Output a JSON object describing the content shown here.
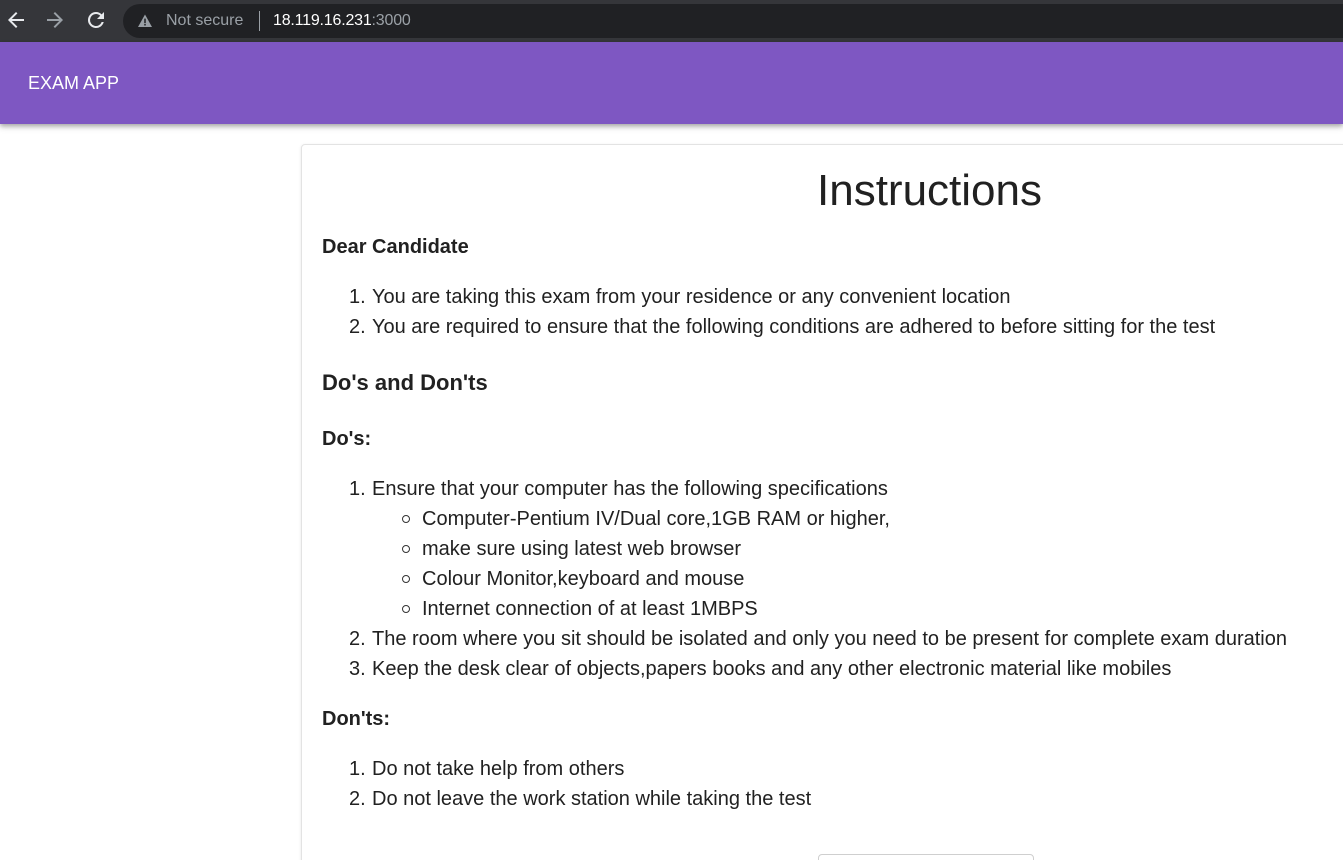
{
  "browser": {
    "not_secure": "Not secure",
    "url_host": "18.119.16.231",
    "url_port": ":3000"
  },
  "app": {
    "title": "EXAM APP",
    "accent": "#7e57c2"
  },
  "instructions": {
    "title": "Instructions",
    "greeting": "Dear Candidate",
    "intro": [
      "You are taking this exam from your residence or any convenient location",
      "You are required to ensure that the following conditions are adhered to before sitting for the test"
    ],
    "section_heading": "Do's and Don'ts",
    "dos_heading": "Do's:",
    "dos": [
      "Ensure that your computer has the following specifications",
      "The room where you sit should be isolated and only you need to be present for complete exam duration",
      "Keep the desk clear of objects,papers books and any other electronic material like mobiles"
    ],
    "specs": [
      "Computer-Pentium IV/Dual core,1GB RAM or higher,",
      "make sure using latest web browser",
      "Colour Monitor,keyboard and mouse",
      "Internet connection of at least 1MBPS"
    ],
    "donts_heading": "Don'ts:",
    "donts": [
      "Do not take help from others",
      "Do not leave the work station while taking the test"
    ],
    "numbers": [
      "1.",
      "2.",
      "3."
    ]
  }
}
